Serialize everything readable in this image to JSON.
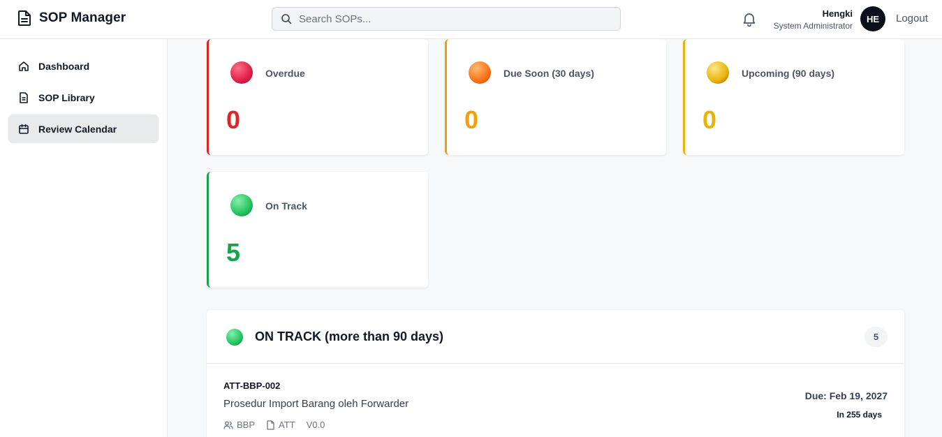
{
  "app": {
    "title": "SOP Manager"
  },
  "search": {
    "placeholder": "Search SOPs..."
  },
  "user": {
    "name": "Hengki",
    "role": "System Administrator",
    "initials": "HE",
    "logout_label": "Logout"
  },
  "sidebar": {
    "items": [
      {
        "label": "Dashboard",
        "icon": "home-icon"
      },
      {
        "label": "SOP Library",
        "icon": "document-icon"
      },
      {
        "label": "Review Calendar",
        "icon": "calendar-icon",
        "active": true
      }
    ]
  },
  "stats": [
    {
      "label": "Overdue",
      "value": "0",
      "color": "#dc2626"
    },
    {
      "label": "Due Soon (30 days)",
      "value": "0",
      "color": "#f59e0b"
    },
    {
      "label": "Upcoming (90 days)",
      "value": "0",
      "color": "#eab308"
    },
    {
      "label": "On Track",
      "value": "5",
      "color": "#16a34a"
    }
  ],
  "section": {
    "title": "ON TRACK (more than 90 days)",
    "count": "5",
    "items": [
      {
        "code": "ATT-BBP-002",
        "title": "Prosedur Import Barang oleh Forwarder",
        "department": "BBP",
        "category": "ATT",
        "version": "V0.0",
        "due": "Due: Feb 19, 2027",
        "remaining": "In 255 days"
      }
    ]
  }
}
